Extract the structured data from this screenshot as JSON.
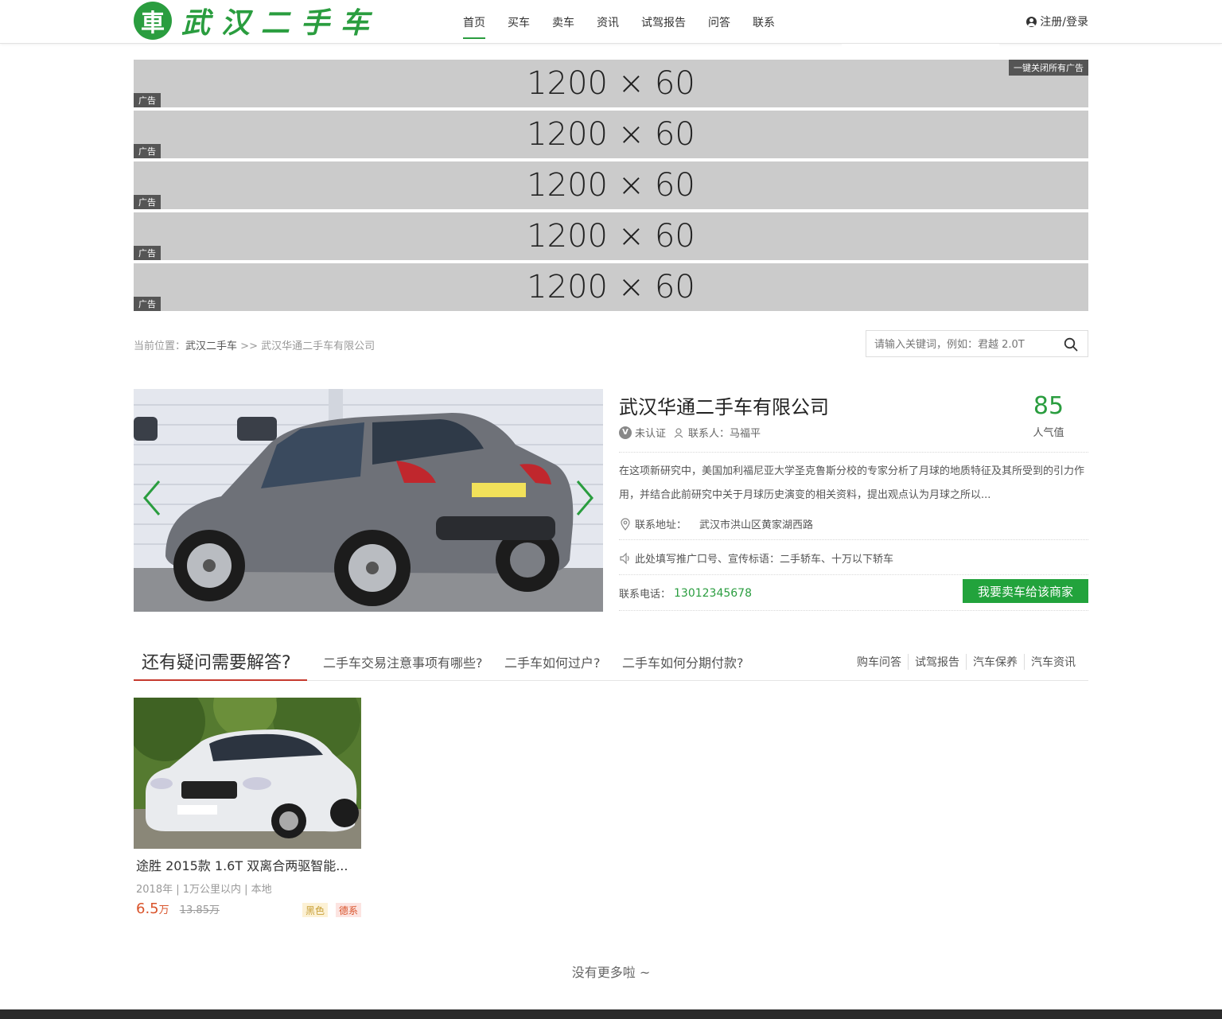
{
  "header": {
    "logo_badge": "車",
    "logo_text": "武汉二手车",
    "nav": [
      "首页",
      "买车",
      "卖车",
      "资讯",
      "试驾报告",
      "问答",
      "联系"
    ],
    "active_nav": 0,
    "login_label": "注册/登录"
  },
  "ads": {
    "items": [
      "1200 × 60",
      "1200 × 60",
      "1200 × 60",
      "1200 × 60",
      "1200 × 60"
    ],
    "tag_label": "广告",
    "close_all_label": "一键关闭所有广告"
  },
  "breadcrumb": {
    "prefix": "当前位置：",
    "home": "武汉二手车",
    "separator": ">>",
    "current": "武汉华通二手车有限公司"
  },
  "search": {
    "placeholder": "请输入关键词，例如：君越 2.0T"
  },
  "dealer": {
    "name": "武汉华通二手车有限公司",
    "verify_status": "未认证",
    "contact_person": "联系人：马福平",
    "popularity_value": "85",
    "popularity_label": "人气值",
    "description": "在这项新研究中，美国加利福尼亚大学圣克鲁斯分校的专家分析了月球的地质特征及其所受到的引力作用，并结合此前研究中关于月球历史演变的相关资料，提出观点认为月球之所以...",
    "address_label": "联系地址：",
    "address": "武汉市洪山区黄家湖西路",
    "slogan": "此处填写推广口号、宣传标语：二手轿车、十万以下轿车",
    "phone_label": "联系电话：",
    "phone": "13012345678",
    "sell_button": "我要卖车给该商家"
  },
  "qa": {
    "title": "还有疑问需要解答?",
    "questions": [
      "二手车交易注意事项有哪些?",
      "二手车如何过户?",
      "二手车如何分期付款?"
    ],
    "links": [
      "购车问答",
      "试驾报告",
      "汽车保养",
      "汽车资讯"
    ]
  },
  "listings": [
    {
      "title": "途胜 2015款 1.6T 双离合两驱智能...",
      "meta": "2018年 | 1万公里以内 | 本地",
      "price": "6.5",
      "price_unit": "万",
      "old_price": "13.85万",
      "tags": [
        "黑色",
        "德系"
      ]
    }
  ],
  "no_more": "没有更多啦 ~",
  "colors": {
    "brand_green": "#2a9d3f",
    "button_green": "#22a33c",
    "accent_red": "#c63a2e",
    "price_orange": "#d9532a"
  }
}
